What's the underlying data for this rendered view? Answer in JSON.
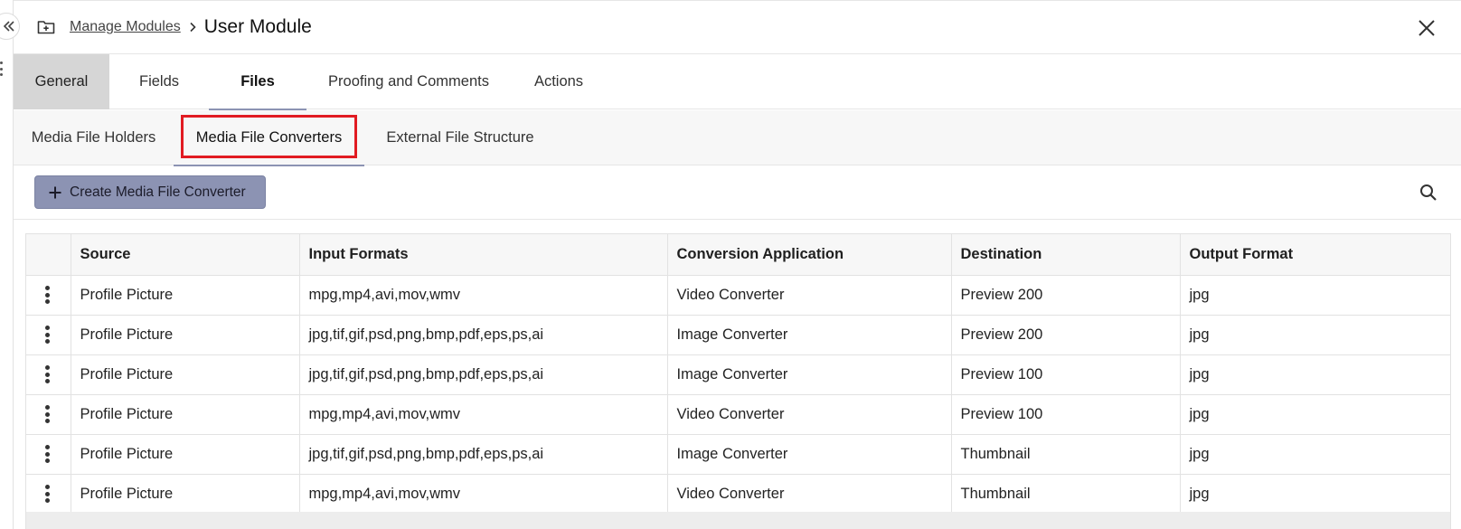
{
  "breadcrumb": {
    "parent": "Manage Modules",
    "current": "User Module"
  },
  "main_tabs": [
    {
      "label": "General"
    },
    {
      "label": "Fields"
    },
    {
      "label": "Files"
    },
    {
      "label": "Proofing and Comments"
    },
    {
      "label": "Actions"
    }
  ],
  "sub_tabs": [
    {
      "label": "Media File Holders"
    },
    {
      "label": "Media File Converters"
    },
    {
      "label": "External File Structure"
    }
  ],
  "toolbar": {
    "create_label": "Create Media File Converter"
  },
  "table": {
    "headers": [
      "Source",
      "Input Formats",
      "Conversion Application",
      "Destination",
      "Output Format"
    ],
    "rows": [
      {
        "source": "Profile Picture",
        "input": "mpg,mp4,avi,mov,wmv",
        "app": "Video Converter",
        "dest": "Preview 200",
        "output": "jpg"
      },
      {
        "source": "Profile Picture",
        "input": "jpg,tif,gif,psd,png,bmp,pdf,eps,ps,ai",
        "app": "Image Converter",
        "dest": "Preview 200",
        "output": "jpg"
      },
      {
        "source": "Profile Picture",
        "input": "jpg,tif,gif,psd,png,bmp,pdf,eps,ps,ai",
        "app": "Image Converter",
        "dest": "Preview 100",
        "output": "jpg"
      },
      {
        "source": "Profile Picture",
        "input": "mpg,mp4,avi,mov,wmv",
        "app": "Video Converter",
        "dest": "Preview 100",
        "output": "jpg"
      },
      {
        "source": "Profile Picture",
        "input": "jpg,tif,gif,psd,png,bmp,pdf,eps,ps,ai",
        "app": "Image Converter",
        "dest": "Thumbnail",
        "output": "jpg"
      },
      {
        "source": "Profile Picture",
        "input": "mpg,mp4,avi,mov,wmv",
        "app": "Video Converter",
        "dest": "Thumbnail",
        "output": "jpg"
      }
    ]
  },
  "colors": {
    "accent": "#8c93b3",
    "highlight": "#e11b22",
    "active_tab_bg": "#d6d6d6"
  },
  "icons": {
    "collapse": "double-chevron-left-icon",
    "folder": "folder-plus-icon",
    "breadcrumb_sep": "chevron-right-icon",
    "close": "close-icon",
    "create": "plus-icon",
    "search": "search-icon",
    "row_menu": "kebab-menu-icon"
  }
}
